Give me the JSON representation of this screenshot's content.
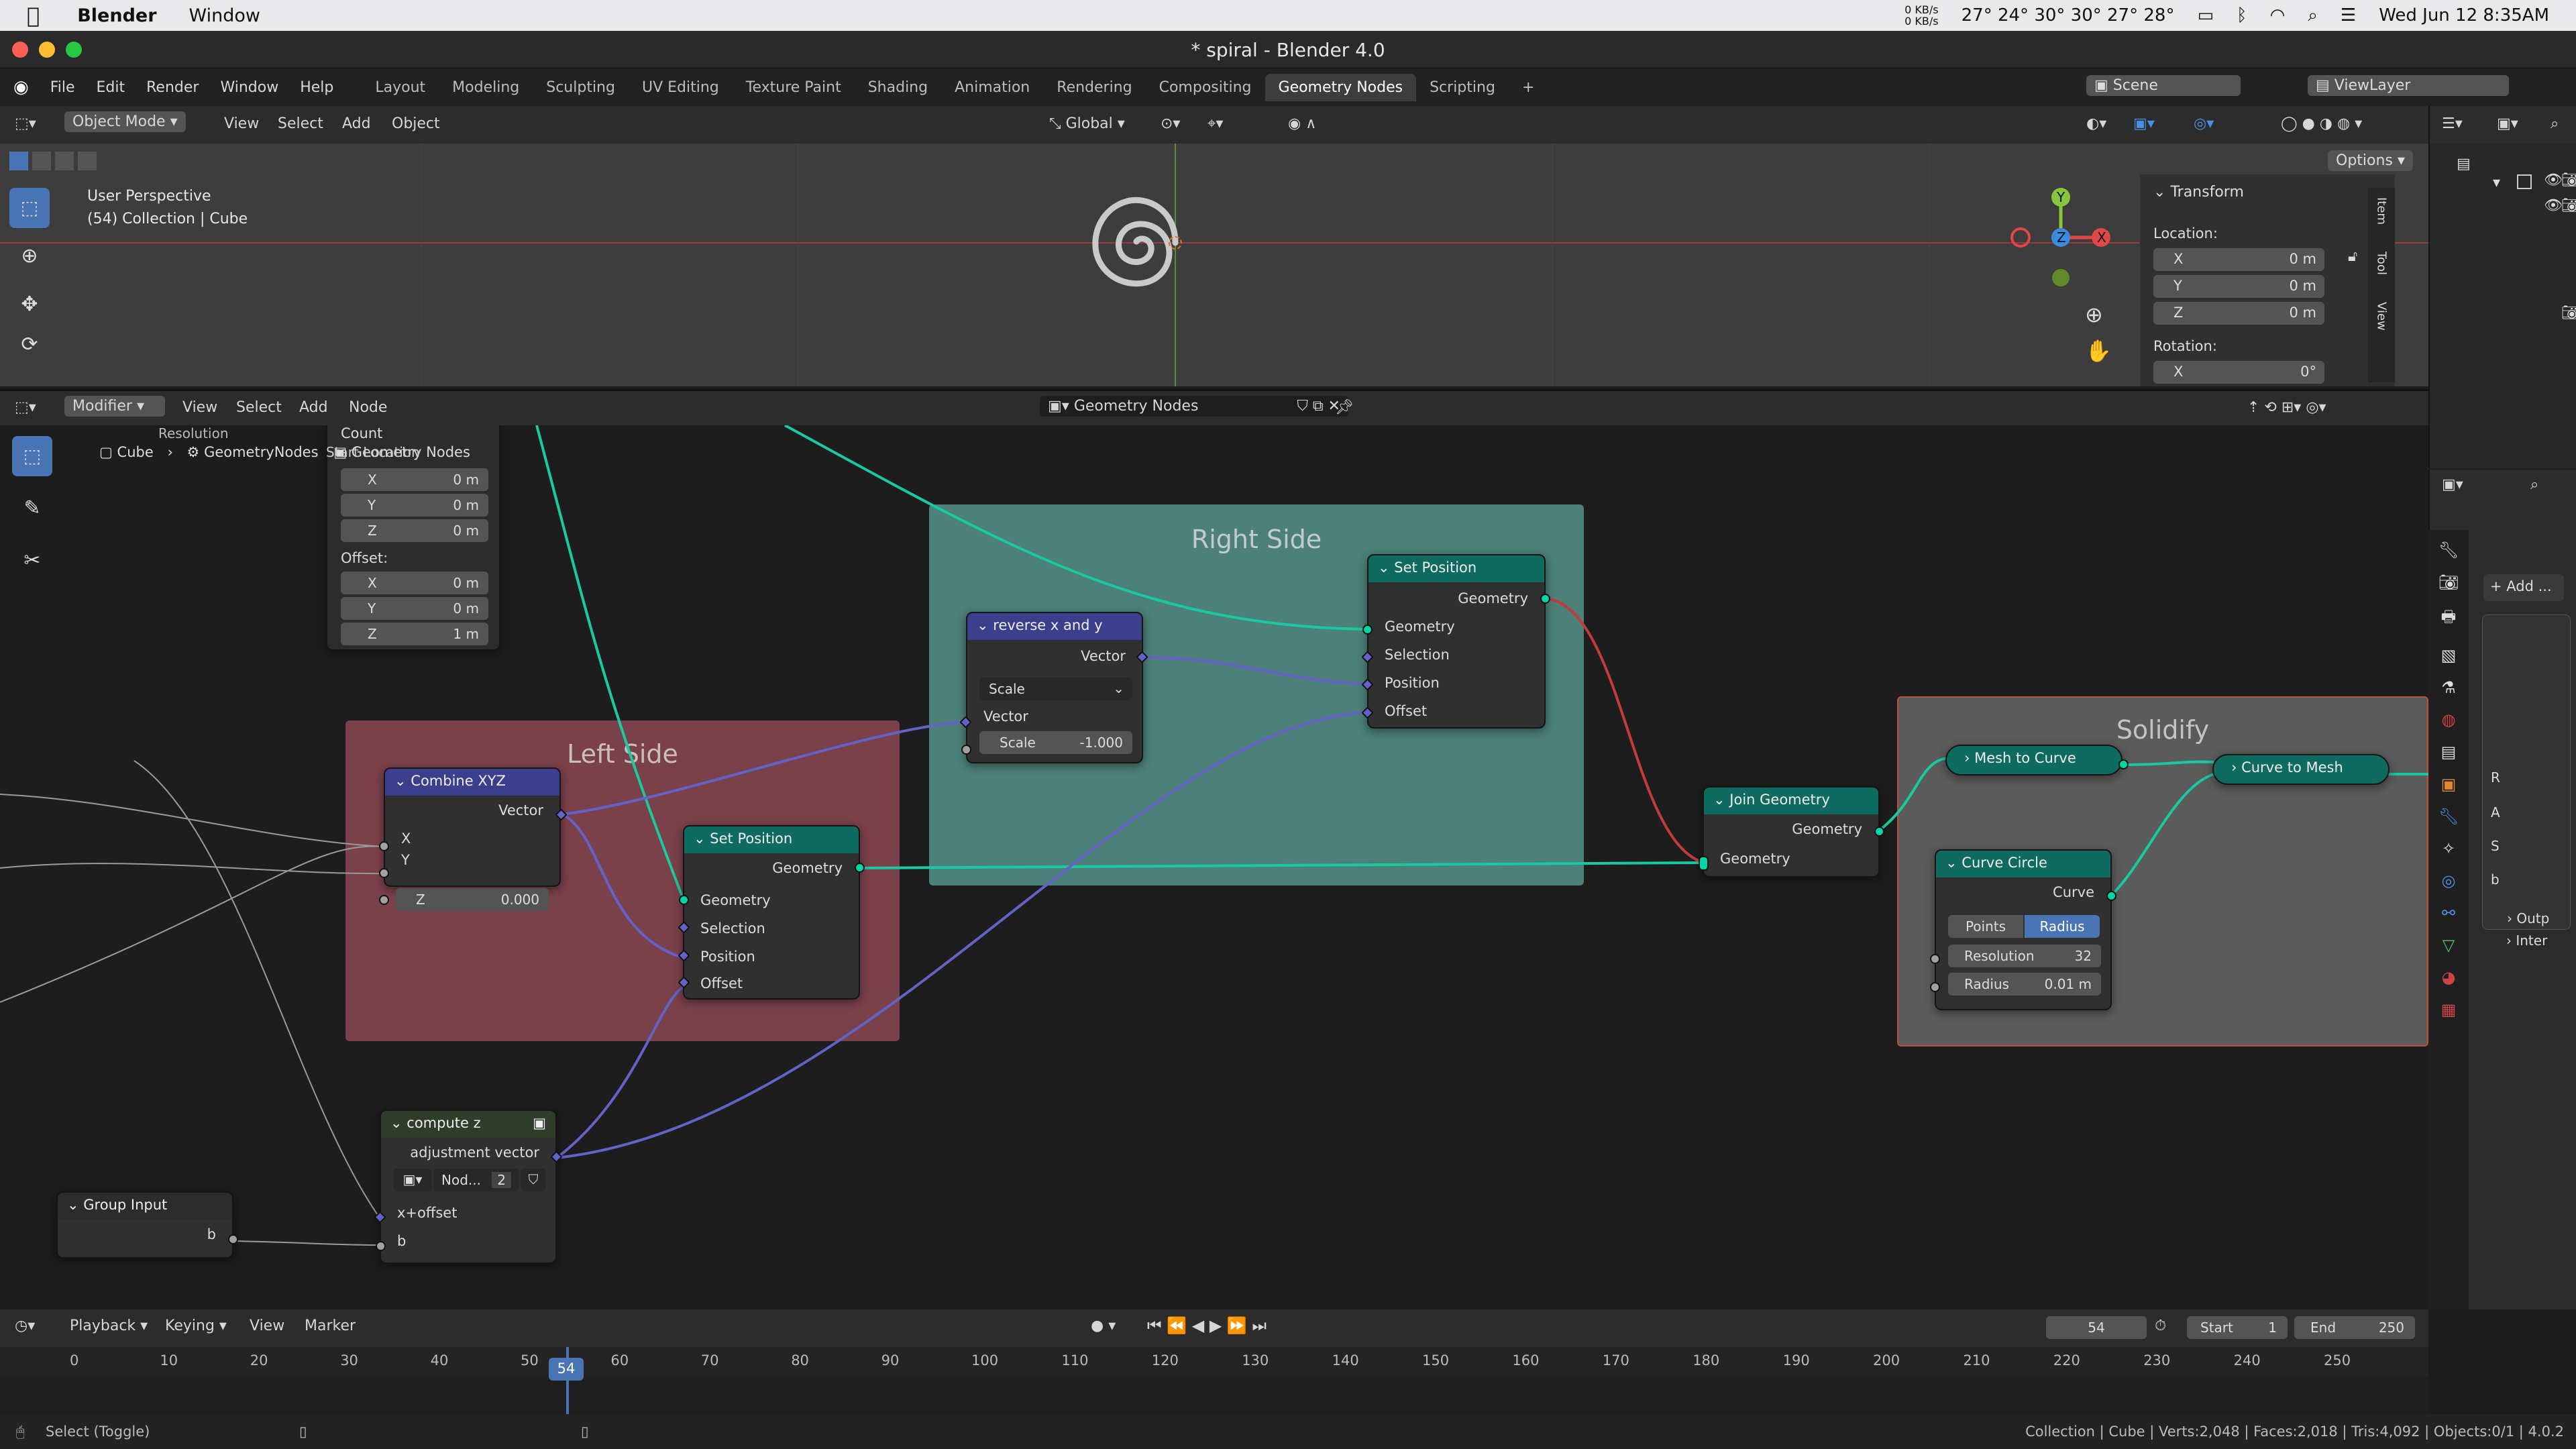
{
  "macbar": {
    "apple_icon": "apple-icon",
    "app_name": "Blender",
    "menu_window": "Window",
    "net_rates": "0 KB/s\n0 KB/s",
    "temps": "27° 24° 30° 30° 27° 28°",
    "datetime": "Wed Jun 12  8:35AM"
  },
  "window": {
    "title": "* spiral - Blender 4.0"
  },
  "topmenu": {
    "items": [
      "File",
      "Edit",
      "Render",
      "Window",
      "Help"
    ],
    "workspaces": [
      "Layout",
      "Modeling",
      "Sculpting",
      "UV Editing",
      "Texture Paint",
      "Shading",
      "Animation",
      "Rendering",
      "Compositing",
      "Geometry Nodes",
      "Scripting"
    ],
    "active_workspace": "Geometry Nodes",
    "scene": "Scene",
    "view_layer": "ViewLayer"
  },
  "viewport": {
    "mode": "Object Mode",
    "menus": [
      "View",
      "Select",
      "Add",
      "Object"
    ],
    "orientation": "Global",
    "options": "Options",
    "overlay_line1": "User Perspective",
    "overlay_line2": "(54) Collection | Cube",
    "gizmo_axes": [
      "Y",
      "Z",
      "X"
    ]
  },
  "npanel": {
    "section": "Transform",
    "location_label": "Location:",
    "location": [
      {
        "axis": "X",
        "value": "0 m"
      },
      {
        "axis": "Y",
        "value": "0 m"
      },
      {
        "axis": "Z",
        "value": "0 m"
      }
    ],
    "rotation_label": "Rotation:",
    "rotation": [
      {
        "axis": "X",
        "value": "0°"
      }
    ],
    "tabs": [
      "Item",
      "Tool",
      "View"
    ]
  },
  "node_editor": {
    "editor_type": "Modifier",
    "menus": [
      "View",
      "Select",
      "Add",
      "Node"
    ],
    "tree_name": "Geometry Nodes",
    "breadcrumb": [
      "Cube",
      "GeometryNodes",
      "Geometry Nodes"
    ],
    "overlap_text": "Start Location",
    "top_node": {
      "rows_top": [
        "Resolution",
        "Count"
      ],
      "xyz": [
        {
          "axis": "X",
          "value": "0 m"
        },
        {
          "axis": "Y",
          "value": "0 m"
        },
        {
          "axis": "Z",
          "value": "0 m"
        }
      ],
      "offset_label": "Offset:",
      "offset": [
        {
          "axis": "X",
          "value": "0 m"
        },
        {
          "axis": "Y",
          "value": "0 m"
        },
        {
          "axis": "Z",
          "value": "1 m"
        }
      ]
    },
    "frames": {
      "right": "Right Side",
      "left": "Left Side",
      "solidify": "Solidify"
    },
    "set_position_right": {
      "title": "Set Position",
      "out": "Geometry",
      "inputs": [
        "Geometry",
        "Selection",
        "Position",
        "Offset"
      ]
    },
    "reverse": {
      "title": "reverse x and y",
      "out": "Vector",
      "op": "Scale",
      "in": "Vector",
      "scale_label": "Scale",
      "scale_value": "-1.000"
    },
    "combine": {
      "title": "Combine XYZ",
      "out": "Vector",
      "inputs": [
        "X",
        "Y"
      ],
      "z_label": "Z",
      "z_value": "0.000"
    },
    "set_position_left": {
      "title": "Set Position",
      "out": "Geometry",
      "inputs": [
        "Geometry",
        "Selection",
        "Position",
        "Offset"
      ]
    },
    "join": {
      "title": "Join Geometry",
      "out": "Geometry",
      "in": "Geometry"
    },
    "mesh_to_curve": {
      "title": "Mesh to Curve"
    },
    "curve_to_mesh": {
      "title": "Curve to Mesh"
    },
    "curve_circle": {
      "title": "Curve Circle",
      "out": "Curve",
      "mode_points": "Points",
      "mode_radius": "Radius",
      "res_label": "Resolution",
      "res_value": "32",
      "radius_label": "Radius",
      "radius_value": "0.01 m"
    },
    "compute_z": {
      "title": "compute z",
      "out": "adjustment vector",
      "group_name": "Nod...",
      "users": "2",
      "inputs": [
        "x+offset",
        "b"
      ]
    },
    "group_input": {
      "title": "Group Input",
      "out": "b"
    }
  },
  "props": {
    "add_modifier": "Add ...",
    "items": [
      "Outp",
      "Inter"
    ],
    "letters": [
      "R",
      "A",
      "S",
      "b"
    ]
  },
  "timeline": {
    "menus": [
      "Playback",
      "Keying",
      "View",
      "Marker"
    ],
    "current_frame": "54",
    "start_label": "Start",
    "start": "1",
    "end_label": "End",
    "end": "250",
    "ticks": [
      "0",
      "10",
      "20",
      "30",
      "40",
      "50",
      "60",
      "70",
      "80",
      "90",
      "100",
      "110",
      "120",
      "130",
      "140",
      "150",
      "160",
      "170",
      "180",
      "190",
      "200",
      "210",
      "220",
      "230",
      "240",
      "250"
    ]
  },
  "status": {
    "left": "Select (Toggle)",
    "right": "Collection | Cube | Verts:2,048 | Faces:2,018 | Tris:4,092 | Objects:0/1 | 4.0.2"
  }
}
